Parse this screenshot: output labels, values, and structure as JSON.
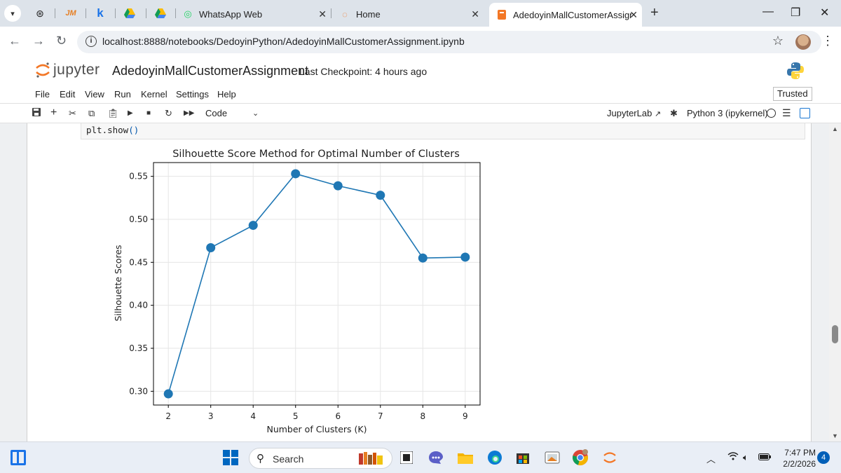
{
  "browser": {
    "tabs": [
      {
        "title": "WhatsApp Web",
        "icon": "whatsapp-icon"
      },
      {
        "title": "Home",
        "icon": "jupyter-icon"
      },
      {
        "title": "AdedoyinMallCustomerAssignm",
        "icon": "notebook-icon",
        "active": true
      }
    ],
    "url": "localhost:8888/notebooks/DedoyinPython/AdedoyinMallCustomerAssignment.ipynb"
  },
  "jupyter": {
    "brand": "jupyter",
    "notebook_title": "AdedoyinMallCustomerAssignment",
    "checkpoint": "Last Checkpoint: 4 hours ago",
    "menu": [
      "File",
      "Edit",
      "View",
      "Run",
      "Kernel",
      "Settings",
      "Help"
    ],
    "trusted": "Trusted",
    "cell_type": "Code",
    "jupyterlab_link": "JupyterLab",
    "kernel": "Python 3 (ipykernel)"
  },
  "cell": {
    "code_fn": "plt.show",
    "code_paren": "()"
  },
  "chart_data": {
    "type": "line",
    "title": "Silhouette Score Method for Optimal Number of Clusters",
    "xlabel": "Number of Clusters (K)",
    "ylabel": "Silhouette Scores",
    "x": [
      2,
      3,
      4,
      5,
      6,
      7,
      8,
      9
    ],
    "y": [
      0.297,
      0.467,
      0.493,
      0.553,
      0.539,
      0.528,
      0.455,
      0.456
    ],
    "xticks": [
      2,
      3,
      4,
      5,
      6,
      7,
      8,
      9
    ],
    "yticks": [
      0.3,
      0.35,
      0.4,
      0.45,
      0.5,
      0.55
    ],
    "ytick_labels": [
      "0.30",
      "0.35",
      "0.40",
      "0.45",
      "0.50",
      "0.55"
    ],
    "xlim": [
      1.65,
      9.35
    ],
    "ylim": [
      0.284,
      0.566
    ],
    "grid": true,
    "marker": "circle",
    "color": "#1f77b4"
  },
  "taskbar": {
    "search_placeholder": "Search",
    "time": "7:47 PM",
    "date": "2/2/2026",
    "notifications": "4"
  }
}
